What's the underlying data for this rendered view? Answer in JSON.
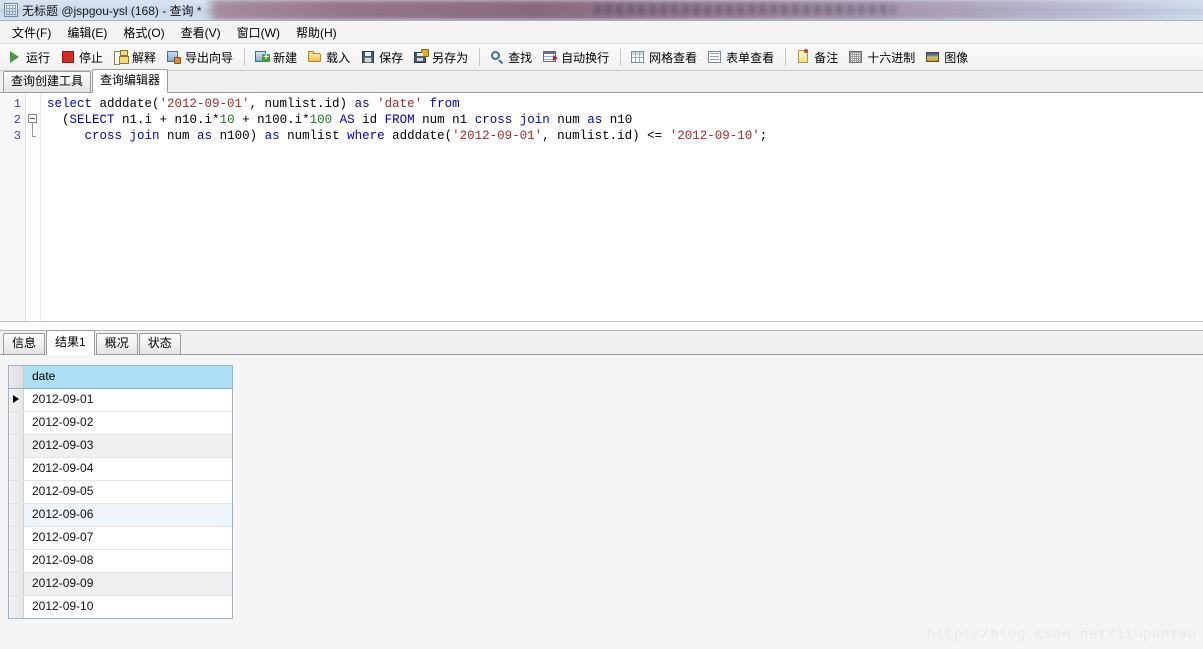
{
  "window": {
    "title": "无标题 @jspgou-ysl (168) - 查询 *",
    "icon": "grid-window-icon",
    "redacted_region": true
  },
  "menubar": {
    "items": [
      {
        "label": "文件(F)",
        "name": "menu-file"
      },
      {
        "label": "编辑(E)",
        "name": "menu-edit"
      },
      {
        "label": "格式(O)",
        "name": "menu-format"
      },
      {
        "label": "查看(V)",
        "name": "menu-view"
      },
      {
        "label": "窗口(W)",
        "name": "menu-window"
      },
      {
        "label": "帮助(H)",
        "name": "menu-help"
      }
    ]
  },
  "toolbar": {
    "groups": [
      {
        "buttons": [
          {
            "label": "运行",
            "icon": "run-play-icon",
            "name": "toolbar-run"
          },
          {
            "label": "停止",
            "icon": "stop-square-icon",
            "name": "toolbar-stop"
          },
          {
            "label": "解释",
            "icon": "explain-tree-icon",
            "name": "toolbar-explain"
          },
          {
            "label": "导出向导",
            "icon": "export-wizard-icon",
            "name": "toolbar-export-wizard"
          }
        ]
      },
      {
        "buttons": [
          {
            "label": "新建",
            "icon": "new-document-icon",
            "name": "toolbar-new"
          },
          {
            "label": "载入",
            "icon": "open-folder-icon",
            "name": "toolbar-load"
          },
          {
            "label": "保存",
            "icon": "save-floppy-icon",
            "name": "toolbar-save"
          },
          {
            "label": "另存为",
            "icon": "save-as-icon",
            "name": "toolbar-save-as"
          }
        ]
      },
      {
        "buttons": [
          {
            "label": "查找",
            "icon": "search-magnifier-icon",
            "name": "toolbar-find"
          },
          {
            "label": "自动换行",
            "icon": "word-wrap-icon",
            "name": "toolbar-word-wrap"
          }
        ]
      },
      {
        "buttons": [
          {
            "label": "网格查看",
            "icon": "grid-view-icon",
            "name": "toolbar-grid-view"
          },
          {
            "label": "表单查看",
            "icon": "form-view-icon",
            "name": "toolbar-form-view"
          }
        ]
      },
      {
        "buttons": [
          {
            "label": "备注",
            "icon": "note-icon",
            "name": "toolbar-note"
          },
          {
            "label": "十六进制",
            "icon": "hex-icon",
            "name": "toolbar-hex"
          },
          {
            "label": "图像",
            "icon": "image-icon",
            "name": "toolbar-image"
          }
        ]
      }
    ]
  },
  "editor_tabs": {
    "items": [
      {
        "label": "查询创建工具",
        "active": false
      },
      {
        "label": "查询编辑器",
        "active": true
      }
    ]
  },
  "editor": {
    "line_numbers": [
      "1",
      "2",
      "3"
    ],
    "lines": [
      [
        {
          "t": "select ",
          "c": "kw"
        },
        {
          "t": "adddate(",
          "c": ""
        },
        {
          "t": "'2012-09-01'",
          "c": "str"
        },
        {
          "t": ", numlist.id) ",
          "c": ""
        },
        {
          "t": "as ",
          "c": "kw"
        },
        {
          "t": "'date' ",
          "c": "str"
        },
        {
          "t": "from",
          "c": "kw"
        }
      ],
      [
        {
          "t": "  (",
          "c": ""
        },
        {
          "t": "SELECT ",
          "c": "kw"
        },
        {
          "t": "n1.i + n10.i*",
          "c": ""
        },
        {
          "t": "10",
          "c": "num"
        },
        {
          "t": " + n100.i*",
          "c": ""
        },
        {
          "t": "100",
          "c": "num"
        },
        {
          "t": " ",
          "c": ""
        },
        {
          "t": "AS ",
          "c": "kw"
        },
        {
          "t": "id ",
          "c": ""
        },
        {
          "t": "FROM ",
          "c": "kw"
        },
        {
          "t": "num n1 ",
          "c": ""
        },
        {
          "t": "cross join ",
          "c": "kw"
        },
        {
          "t": "num ",
          "c": ""
        },
        {
          "t": "as ",
          "c": "kw"
        },
        {
          "t": "n10",
          "c": ""
        }
      ],
      [
        {
          "t": "     ",
          "c": ""
        },
        {
          "t": "cross join ",
          "c": "kw"
        },
        {
          "t": "num ",
          "c": ""
        },
        {
          "t": "as ",
          "c": "kw"
        },
        {
          "t": "n100) ",
          "c": ""
        },
        {
          "t": "as ",
          "c": "kw"
        },
        {
          "t": "numlist ",
          "c": ""
        },
        {
          "t": "where ",
          "c": "kw"
        },
        {
          "t": "adddate(",
          "c": ""
        },
        {
          "t": "'2012-09-01'",
          "c": "str"
        },
        {
          "t": ", numlist.id) <= ",
          "c": ""
        },
        {
          "t": "'2012-09-10'",
          "c": "str"
        },
        {
          "t": ";",
          "c": ""
        }
      ]
    ],
    "fold_marker_line": 2
  },
  "result_tabs": {
    "items": [
      {
        "label": "信息",
        "active": false
      },
      {
        "label": "结果1",
        "active": true
      },
      {
        "label": "概况",
        "active": false
      },
      {
        "label": "状态",
        "active": false
      }
    ]
  },
  "result_grid": {
    "columns": [
      "date"
    ],
    "current_row_index": 0,
    "rows": [
      {
        "date": "2012-09-01",
        "shade": "white"
      },
      {
        "date": "2012-09-02",
        "shade": "white"
      },
      {
        "date": "2012-09-03",
        "shade": "gray"
      },
      {
        "date": "2012-09-04",
        "shade": "white"
      },
      {
        "date": "2012-09-05",
        "shade": "white"
      },
      {
        "date": "2012-09-06",
        "shade": "blue"
      },
      {
        "date": "2012-09-07",
        "shade": "white"
      },
      {
        "date": "2012-09-08",
        "shade": "white"
      },
      {
        "date": "2012-09-09",
        "shade": "gray"
      },
      {
        "date": "2012-09-10",
        "shade": "white"
      }
    ]
  },
  "watermark": {
    "text": "http://blog.csdn.net/liupantao"
  },
  "colors": {
    "keyword": "#0000cd",
    "string": "#a52a2a",
    "number": "#1a7a1a",
    "grid_header": "#aee0f5",
    "accent": "#3d6ea8"
  }
}
